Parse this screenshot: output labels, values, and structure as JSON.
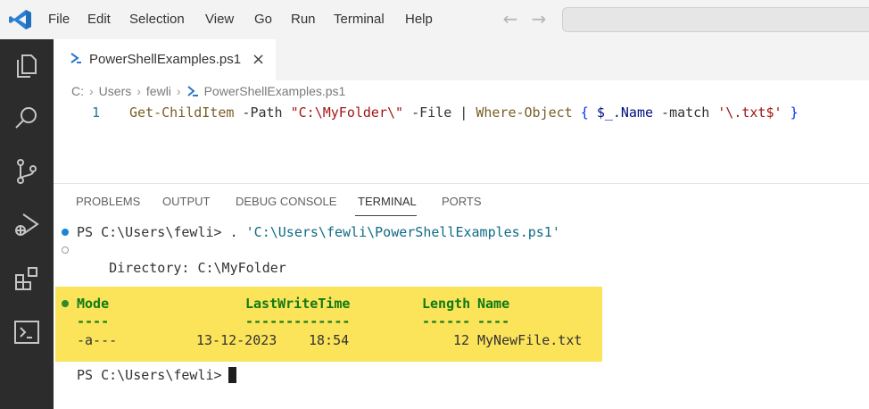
{
  "menu": [
    "File",
    "Edit",
    "Selection",
    "View",
    "Go",
    "Run",
    "Terminal",
    "Help"
  ],
  "icons": {
    "app": "vscode-logo-icon",
    "back": "arrow-left-icon",
    "forward": "arrow-right-icon",
    "activity": [
      "explorer-icon",
      "search-icon",
      "source-control-icon",
      "run-debug-icon",
      "extensions-icon",
      "terminal-icon"
    ],
    "tab_file": "powershell-file-icon",
    "tab_close": "close-icon"
  },
  "tab": {
    "label": "PowerShellExamples.ps1",
    "close": "×"
  },
  "breadcrumb": [
    "C:",
    "Users",
    "fewli",
    "PowerShellExamples.ps1"
  ],
  "editor": {
    "line_number": "1",
    "tokens": {
      "cmd1": "Get-ChildItem",
      "param1": " -Path ",
      "str1": "\"C:\\MyFolder\\\"",
      "param2": " -File ",
      "pipe": "| ",
      "cmd2": "Where-Object",
      "space1": " ",
      "brace_open": "{",
      "space2": " ",
      "var": "$_",
      "prop": ".Name",
      "param3": " -match ",
      "str2": "'\\.txt$'",
      "space3": " ",
      "brace_close": "}"
    }
  },
  "panel_tabs": [
    "PROBLEMS",
    "OUTPUT",
    "DEBUG CONSOLE",
    "TERMINAL",
    "PORTS"
  ],
  "panel_active": "TERMINAL",
  "terminal": {
    "prompt1": "PS C:\\Users\\fewli> . ",
    "path1": "'C:\\Users\\fewli\\PowerShellExamples.ps1'",
    "directory": "    Directory: C:\\MyFolder",
    "headers": [
      "Mode",
      "LastWriteTime",
      "Length",
      "Name"
    ],
    "underlines": [
      "----",
      "-------------",
      "------",
      "----"
    ],
    "row": {
      "mode": "-a---",
      "date": "13-12-2023",
      "time": "18:54",
      "length": "12",
      "name": "MyNewFile.txt"
    },
    "prompt2": "PS C:\\Users\\fewli> "
  },
  "colors": {
    "activity_bar": "#2c2c2c",
    "highlight": "#fbe35a",
    "header_green": "#0f7a13",
    "status_dot_blue": "#1a85d6"
  }
}
